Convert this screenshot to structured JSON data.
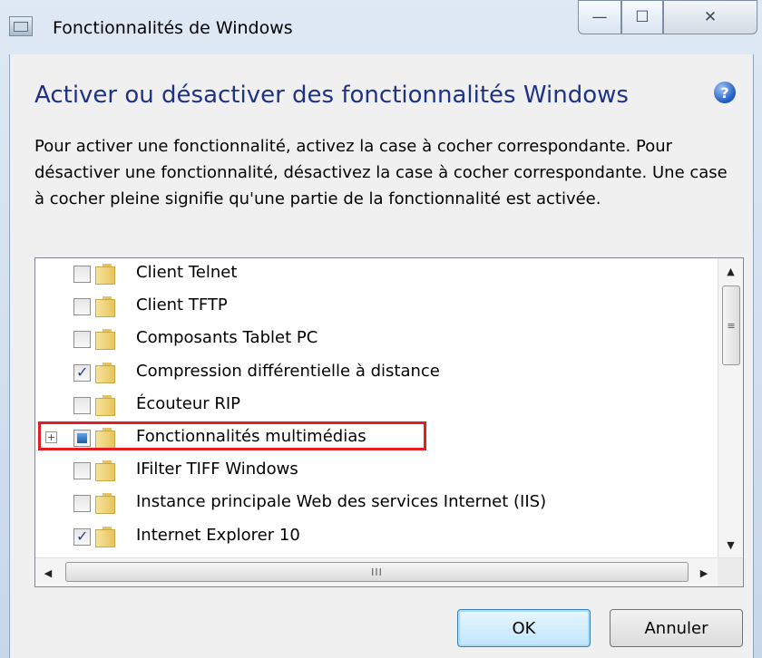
{
  "window": {
    "title": "Fonctionnalités de Windows",
    "controls": {
      "minimize": "—",
      "maximize": "☐",
      "close": "✕"
    }
  },
  "heading": "Activer ou désactiver des fonctionnalités Windows",
  "help_icon": "?",
  "description": "Pour activer une fonctionnalité, activez la case à cocher correspondante. Pour désactiver une fonctionnalité, désactivez la case à cocher correspondante. Une case à cocher pleine signifie qu'une partie de la fonctionnalité est activée.",
  "features": [
    {
      "label": "Client Telnet",
      "state": "unchecked"
    },
    {
      "label": "Client TFTP",
      "state": "unchecked"
    },
    {
      "label": "Composants Tablet PC",
      "state": "unchecked"
    },
    {
      "label": "Compression différentielle à distance",
      "state": "checked"
    },
    {
      "label": "Écouteur RIP",
      "state": "unchecked"
    },
    {
      "label": "Fonctionnalités multimédias",
      "state": "partial",
      "expandable": true,
      "expander": "+",
      "highlighted": true
    },
    {
      "label": "IFilter TIFF Windows",
      "state": "unchecked"
    },
    {
      "label": "Instance principale Web des services Internet (IIS)",
      "state": "unchecked"
    },
    {
      "label": "Internet Explorer 10",
      "state": "checked"
    }
  ],
  "scrollbar": {
    "up": "▲",
    "down": "▼",
    "left": "◀",
    "right": "▶",
    "thumb_v": "≡",
    "thumb_h": "III"
  },
  "buttons": {
    "ok": "OK",
    "cancel": "Annuler"
  },
  "colors": {
    "heading": "#1e3287",
    "highlight_border": "#e01e24",
    "ok_button": "#bee6fd"
  }
}
